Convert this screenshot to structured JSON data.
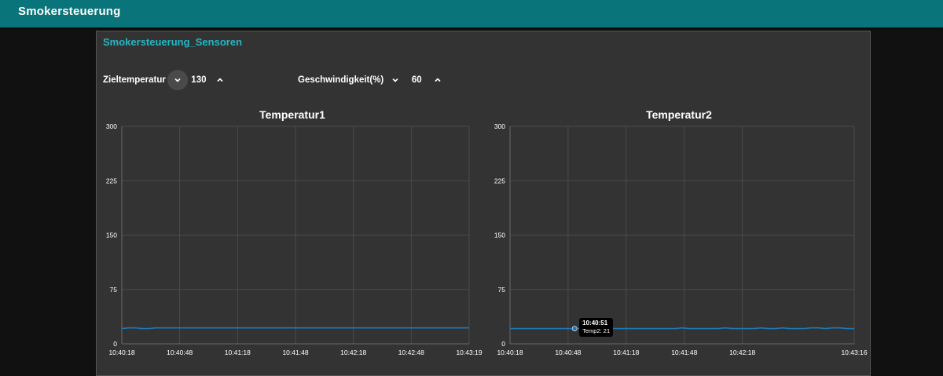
{
  "header": {
    "title": "Smokersteuerung"
  },
  "group": {
    "title": "Smokersteuerung_Sensoren"
  },
  "controls": [
    {
      "label": "Zieltemperatur",
      "value": "130"
    },
    {
      "label": "Geschwindigkeit(%)",
      "value": "60"
    }
  ],
  "colors": {
    "header": "#097479",
    "accent": "#21b8c6",
    "line": "#1f77b4"
  },
  "chart_data": [
    {
      "type": "line",
      "title": "Temperatur1",
      "ylim": [
        0,
        300
      ],
      "y_ticks": [
        "300",
        "225",
        "150",
        "75",
        "0"
      ],
      "x_ticks": [
        "10:40:18",
        "10:40:48",
        "10:41:18",
        "10:41:48",
        "10:42:18",
        "10:42:48",
        "10:43:19"
      ],
      "grid": true,
      "series": [
        {
          "values": [
            21,
            22,
            22,
            21,
            21,
            22,
            22,
            22,
            22,
            22,
            22,
            22,
            22,
            22,
            22,
            22,
            22,
            22,
            22,
            22,
            22,
            22,
            22,
            22,
            22,
            22,
            22,
            22,
            22,
            22,
            22,
            22,
            22,
            22,
            22,
            22,
            22,
            22,
            22,
            22,
            22,
            22,
            22,
            22,
            22,
            22,
            22,
            22,
            22,
            22,
            22,
            22
          ]
        }
      ]
    },
    {
      "type": "line",
      "title": "Temperatur2",
      "ylim": [
        0,
        300
      ],
      "y_ticks": [
        "300",
        "225",
        "150",
        "75",
        "0"
      ],
      "x_ticks": [
        "10:40:18",
        "10:40:48",
        "10:41:18",
        "10:41:48",
        "10:42:18",
        "10:43:16"
      ],
      "grid": true,
      "series": [
        {
          "name": "Temp2",
          "values": [
            21,
            21,
            21,
            21,
            21,
            21,
            21,
            21,
            21,
            21,
            21,
            21,
            21,
            21,
            21,
            21,
            21,
            21,
            21,
            21,
            21,
            21,
            21,
            21,
            22,
            21,
            21,
            21,
            21,
            21,
            22,
            21,
            21,
            21,
            21,
            22,
            21,
            21,
            22,
            21,
            21,
            21,
            22,
            22,
            21,
            22,
            22,
            21,
            21
          ]
        }
      ],
      "tooltip": {
        "time": "10:40:51",
        "text": "Temp2: 21"
      }
    }
  ]
}
